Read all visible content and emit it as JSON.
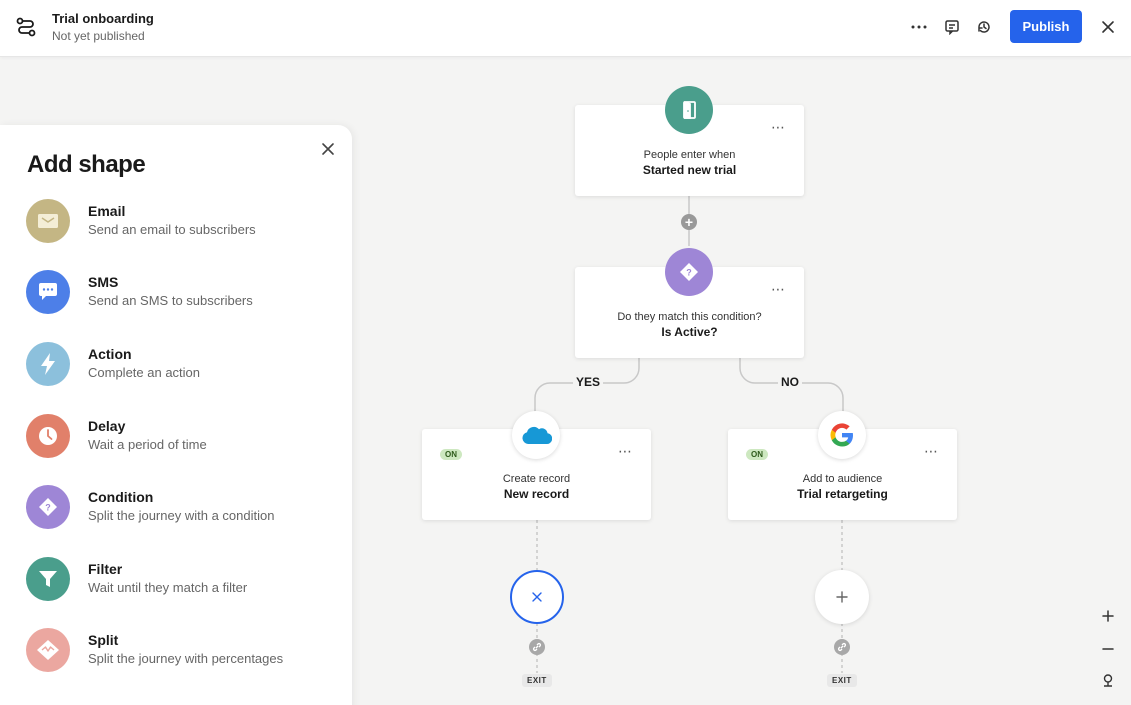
{
  "header": {
    "title": "Trial onboarding",
    "subtitle": "Not yet published",
    "publish_label": "Publish"
  },
  "panel": {
    "title": "Add shape",
    "items": [
      {
        "name": "Email",
        "desc": "Send an email to subscribers",
        "color": "#c4b684",
        "icon": "envelope-icon"
      },
      {
        "name": "SMS",
        "desc": "Send an SMS to subscribers",
        "color": "#4d7fe8",
        "icon": "chat-bubble-icon"
      },
      {
        "name": "Action",
        "desc": "Complete an action",
        "color": "#8cc0dc",
        "icon": "lightning-icon"
      },
      {
        "name": "Delay",
        "desc": "Wait a period of time",
        "color": "#e1806a",
        "icon": "clock-icon"
      },
      {
        "name": "Condition",
        "desc": "Split the journey with a condition",
        "color": "#9e86d6",
        "icon": "diamond-question-icon"
      },
      {
        "name": "Filter",
        "desc": "Wait until they match a filter",
        "color": "#4a9e8c",
        "icon": "funnel-icon"
      },
      {
        "name": "Split",
        "desc": "Split the journey with percentages",
        "color": "#eba7a0",
        "icon": "split-icon"
      }
    ]
  },
  "nodes": {
    "entry": {
      "line1": "People enter when",
      "line2": "Started new trial",
      "color": "#4a9e8c",
      "more": "⋯"
    },
    "condition": {
      "line1": "Do they match this condition?",
      "line2": "Is Active?",
      "color": "#9e86d6",
      "more": "⋯"
    },
    "salesforce": {
      "badge": "ON",
      "line1": "Create record",
      "line2": "New record",
      "more": "⋯"
    },
    "google": {
      "badge": "ON",
      "line1": "Add to audience",
      "line2": "Trial retargeting",
      "more": "⋯"
    }
  },
  "branches": {
    "yes": "YES",
    "no": "NO"
  },
  "exits": {
    "left": "EXIT",
    "right": "EXIT"
  },
  "colors": {
    "accent": "#2563eb",
    "badge_bg": "#cde8c0"
  }
}
